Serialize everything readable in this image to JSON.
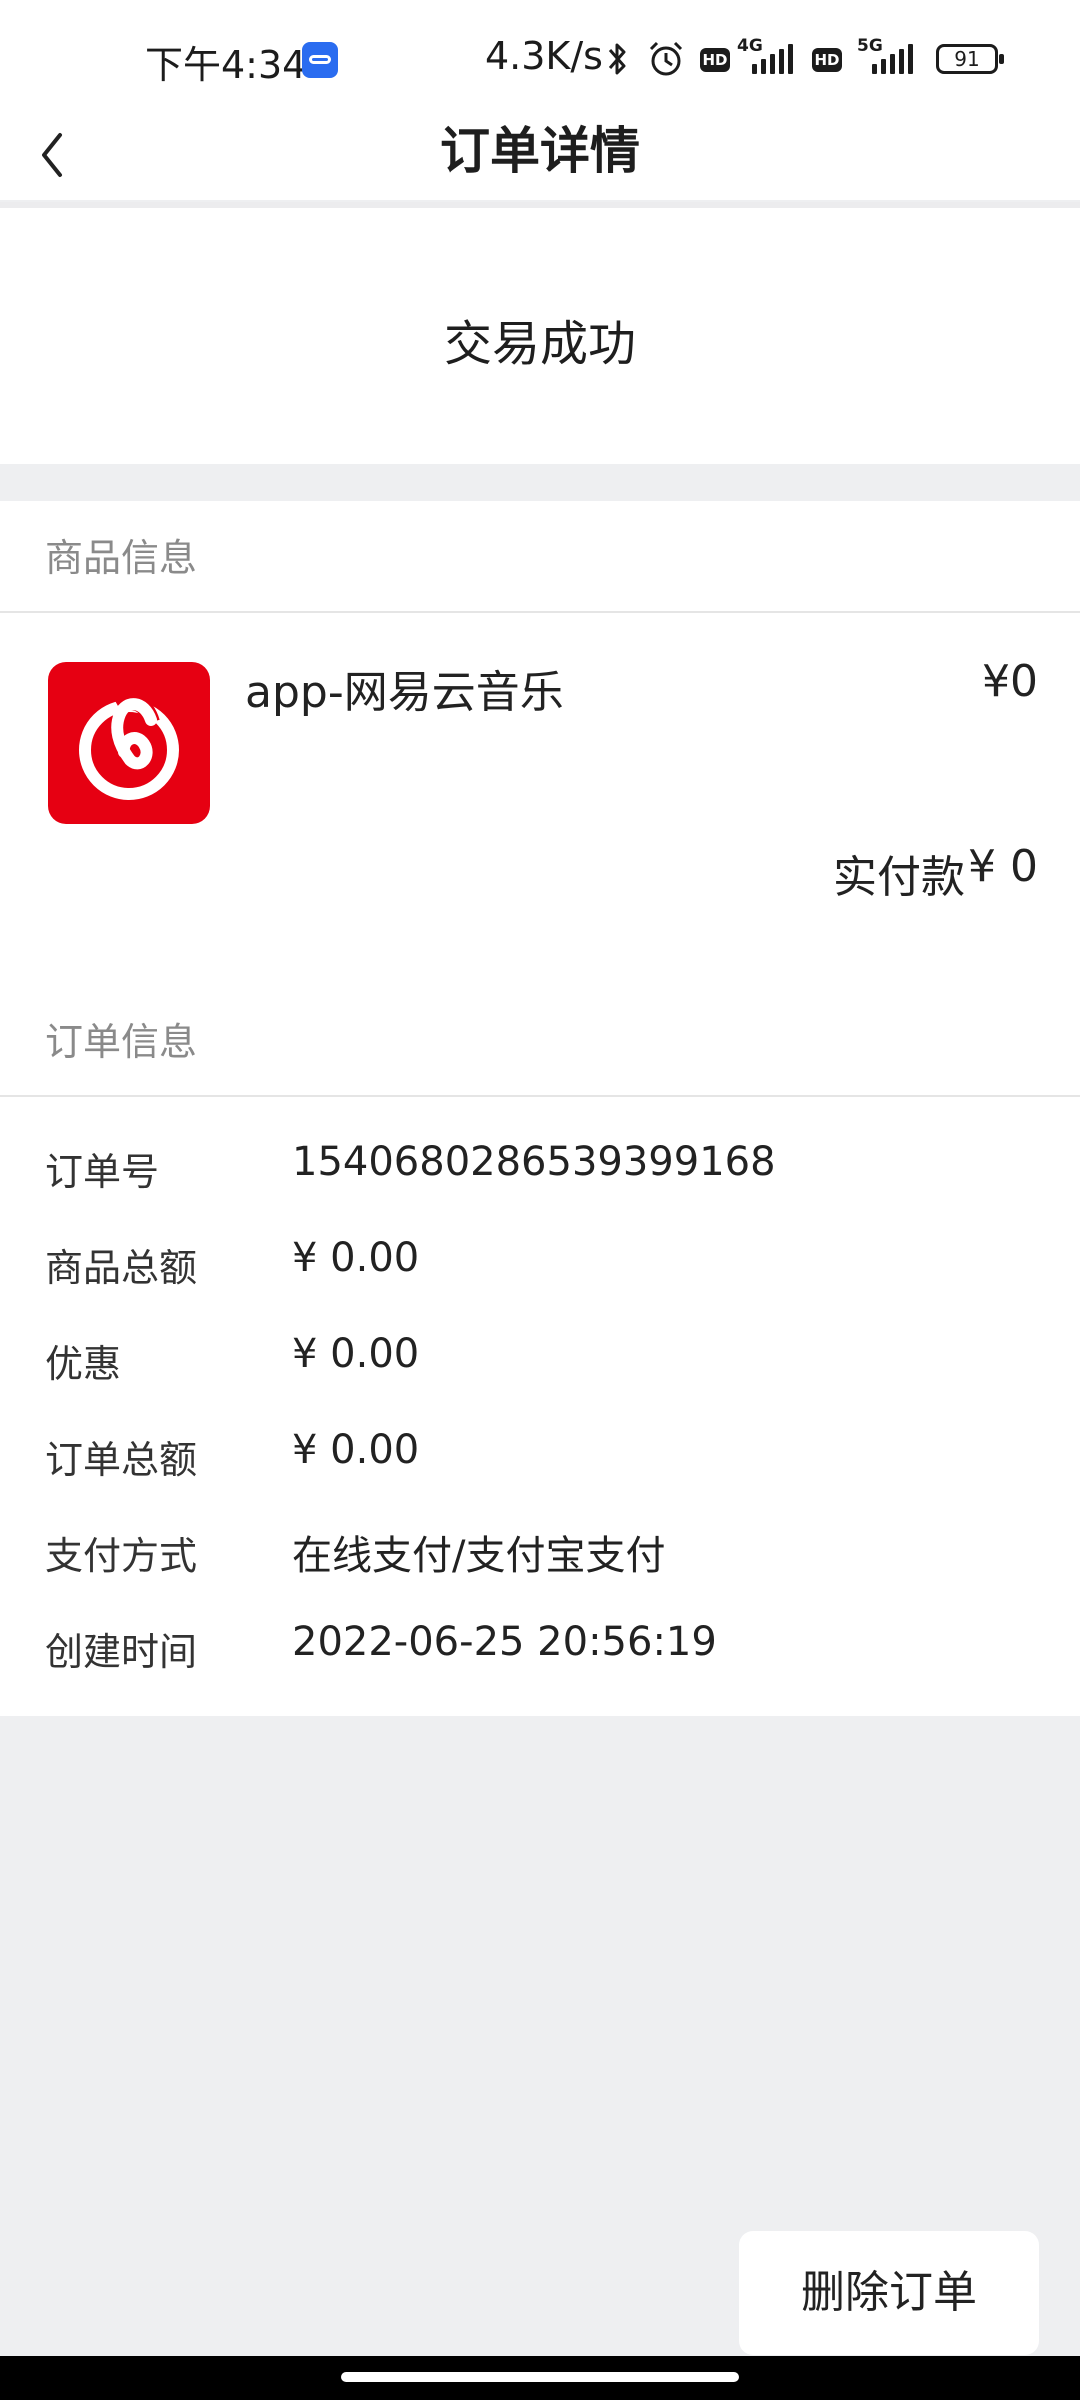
{
  "status_bar": {
    "time": "下午4:34",
    "network_speed": "4.3K/s",
    "sim1_label": "4G",
    "sim2_label": "5G",
    "hd_label": "HD",
    "battery": "91",
    "icons": [
      "car-app-icon",
      "bluetooth-icon",
      "alarm-icon",
      "signal-icon",
      "battery-icon"
    ]
  },
  "header": {
    "title": "订单详情",
    "back_icon": "chevron-left-icon"
  },
  "order_status": "交易成功",
  "product_section": {
    "title": "商品信息",
    "app_icon": "netease-music-icon",
    "app_icon_color": "#e60012",
    "name": "app-网易云音乐",
    "price": "¥0",
    "paid_label": "实付款",
    "paid_value": "¥ 0"
  },
  "order_section": {
    "title": "订单信息",
    "rows": [
      {
        "label": "订单号",
        "value": "1540680286539399168"
      },
      {
        "label": "商品总额",
        "value": "¥ 0.00"
      },
      {
        "label": "优惠",
        "value": "¥ 0.00"
      },
      {
        "label": "订单总额",
        "value": "¥ 0.00"
      },
      {
        "label": "支付方式",
        "value": "在线支付/支付宝支付"
      },
      {
        "label": "创建时间",
        "value": "2022-06-25 20:56:19"
      }
    ]
  },
  "actions": {
    "delete_label": "删除订单"
  }
}
